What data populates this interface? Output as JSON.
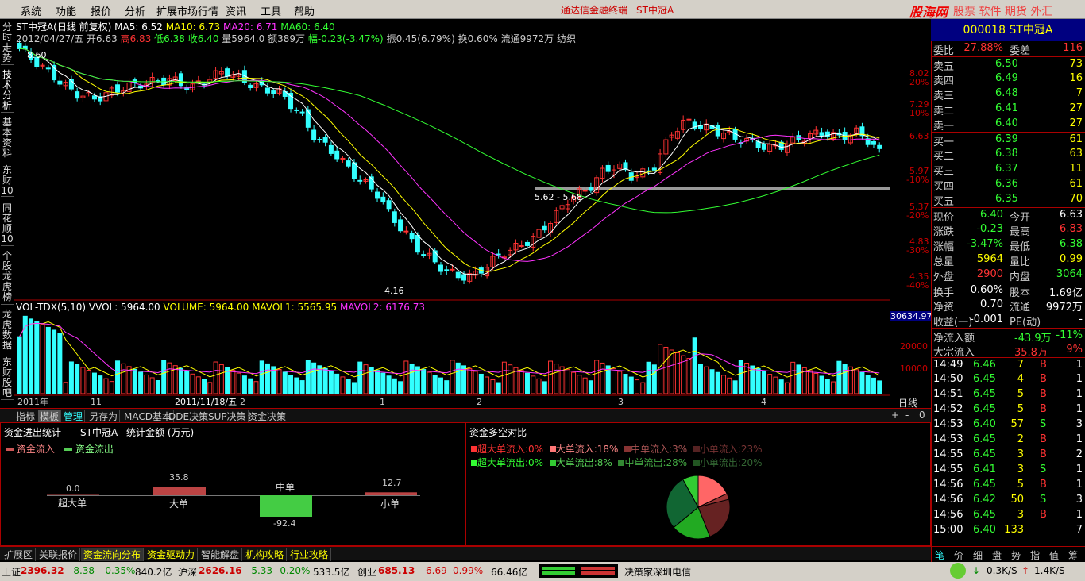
{
  "menu": {
    "items": [
      "系统",
      "功能",
      "报价",
      "分析",
      "扩展市场行情",
      "资讯",
      "工具",
      "帮助"
    ],
    "title_left": "通达信金融终端",
    "title_stock": "ST中冠A",
    "logo": "股海网",
    "logo_sub": "股票 软件 期货 外汇"
  },
  "left_tabs": [
    "分时走势",
    "技术分析",
    "基本资料",
    "东财10",
    "同花顺10",
    "个股龙虎榜",
    "龙虎数据",
    "东财股吧"
  ],
  "chart": {
    "info_line1": {
      "name": "ST中冠A(日线 前复权)",
      "ma5": "MA5: 6.52",
      "ma10": "MA10: 6.73",
      "ma20": "MA20: 6.71",
      "ma60": "MA60: 6.40"
    },
    "info_line2": {
      "date": "2012/04/27/五",
      "open": "开6.63",
      "high": "高6.83",
      "low": "低6.38",
      "close": "收6.40",
      "vol": "量5964.0",
      "amt": "额389万",
      "chg": "幅-0.23(-3.47%)",
      "amp": "振0.45(6.79%)",
      "turn": "换0.60%",
      "float": "流通9972万",
      "sector": "纺织"
    },
    "price_ticks": [
      "8.02",
      "20%",
      "7.29",
      "10%",
      "6.63",
      "5.97",
      "-10%",
      "5.37",
      "-20%",
      "4.83",
      "-30%",
      "4.35",
      "-40%"
    ],
    "annot_high": "8.60",
    "annot_low": "4.16",
    "annot_range": "5.62 - 5.68",
    "vol_line": {
      "name": "VOL-TDX(5,10)",
      "vvol": "VVOL: 5964.00",
      "volume": "VOLUME: 5964.00",
      "mavol1": "MAVOL1: 5565.95",
      "mavol2": "MAVOL2: 6176.73"
    },
    "vol_ticks": [
      "30634.97",
      "20000",
      "10000"
    ],
    "x_labels": [
      "2011年",
      "11",
      "2011/11/18/五",
      "2",
      "1",
      "2",
      "3",
      "4"
    ],
    "period": "日线"
  },
  "bottom_tabs": [
    "指标",
    "模板",
    "管理",
    "另存为",
    "MACD基本",
    "DDE决策",
    "SUP决策",
    "资金决策"
  ],
  "fund_left": {
    "title": "资金进出统计",
    "stock": "ST中冠A",
    "unit": "统计金额 (万元)",
    "legend_in": "资金流入",
    "legend_out": "资金流出",
    "bars": [
      {
        "label": "超大单",
        "value": "0.0"
      },
      {
        "label": "大单",
        "value": "35.8"
      },
      {
        "label": "中单",
        "value": "-92.4"
      },
      {
        "label": "小单",
        "value": "12.7"
      }
    ]
  },
  "fund_right": {
    "title": "资金多空对比",
    "in": [
      {
        "label": "超大单流入:",
        "value": "0%"
      },
      {
        "label": "大单流入:",
        "value": "18%"
      },
      {
        "label": "中单流入:",
        "value": "3%"
      },
      {
        "label": "小单流入:",
        "value": "23%"
      }
    ],
    "out": [
      {
        "label": "超大单流出:",
        "value": "0%"
      },
      {
        "label": "大单流出:",
        "value": "8%"
      },
      {
        "label": "中单流出:",
        "value": "28%"
      },
      {
        "label": "小单流出:",
        "value": "20%"
      }
    ]
  },
  "ext_tabs": [
    "扩展区",
    "关联报价",
    "资金流向分布",
    "资金驱动力",
    "智能解盘",
    "机构攻略",
    "行业攻略"
  ],
  "status": {
    "sh_name": "上证",
    "sh_val": "2396.32",
    "sh_chg": "-8.38",
    "sh_pct": "-0.35%",
    "sh_amt": "840.2亿",
    "sz_name": "沪深",
    "sz_val": "2626.16",
    "sz_chg": "-5.33",
    "sz_pct": "-0.20%",
    "sz_amt": "533.5亿",
    "cy_name": "创业",
    "cy_val": "685.13",
    "cy_chg": "6.69",
    "cy_pct": "0.99%",
    "cy_amt": "66.46亿",
    "broker": "决策家深圳电信",
    "down": "0.3K/S",
    "up": "1.4K/S"
  },
  "quote": {
    "header": "000018 ST中冠A",
    "weibi": {
      "l1": "委比",
      "v1": "27.88%",
      "l2": "委差",
      "v2": "116"
    },
    "sells": [
      {
        "l": "卖五",
        "p": "6.50",
        "v": "73"
      },
      {
        "l": "卖四",
        "p": "6.49",
        "v": "16"
      },
      {
        "l": "卖三",
        "p": "6.48",
        "v": "7"
      },
      {
        "l": "卖二",
        "p": "6.41",
        "v": "27"
      },
      {
        "l": "卖一",
        "p": "6.40",
        "v": "27"
      }
    ],
    "buys": [
      {
        "l": "买一",
        "p": "6.39",
        "v": "61"
      },
      {
        "l": "买二",
        "p": "6.38",
        "v": "63"
      },
      {
        "l": "买三",
        "p": "6.37",
        "v": "11"
      },
      {
        "l": "买四",
        "p": "6.36",
        "v": "61"
      },
      {
        "l": "买五",
        "p": "6.35",
        "v": "70"
      }
    ],
    "stats": [
      {
        "a": "现价",
        "av": "6.40",
        "b": "今开",
        "bv": "6.63"
      },
      {
        "a": "涨跌",
        "av": "-0.23",
        "b": "最高",
        "bv": "6.83"
      },
      {
        "a": "涨幅",
        "av": "-3.47%",
        "b": "最低",
        "bv": "6.38"
      },
      {
        "a": "总量",
        "av": "5964",
        "b": "量比",
        "bv": "0.99"
      },
      {
        "a": "外盘",
        "av": "2900",
        "b": "内盘",
        "bv": "3064"
      },
      {
        "a": "换手",
        "av": "0.60%",
        "b": "股本",
        "bv": "1.69亿"
      },
      {
        "a": "净资",
        "av": "0.70",
        "b": "流通",
        "bv": "9972万"
      },
      {
        "a": "收益(一)",
        "av": "-0.001",
        "b": "PE(动)",
        "bv": "-"
      }
    ],
    "netflow": {
      "l": "净流入额",
      "v": "-43.9万",
      "p": "-11%"
    },
    "bigflow": {
      "l": "大宗流入",
      "v": "35.8万",
      "p": "9%"
    },
    "ticks": [
      {
        "t": "14:49",
        "p": "6.46",
        "v": "7",
        "s": "B",
        "n": "1"
      },
      {
        "t": "14:50",
        "p": "6.45",
        "v": "4",
        "s": "B",
        "n": "1"
      },
      {
        "t": "14:51",
        "p": "6.45",
        "v": "5",
        "s": "B",
        "n": "1"
      },
      {
        "t": "14:52",
        "p": "6.45",
        "v": "5",
        "s": "B",
        "n": "1"
      },
      {
        "t": "14:53",
        "p": "6.40",
        "v": "57",
        "s": "S",
        "n": "3"
      },
      {
        "t": "14:53",
        "p": "6.45",
        "v": "2",
        "s": "B",
        "n": "1"
      },
      {
        "t": "14:55",
        "p": "6.45",
        "v": "3",
        "s": "B",
        "n": "2"
      },
      {
        "t": "14:55",
        "p": "6.41",
        "v": "3",
        "s": "S",
        "n": "1"
      },
      {
        "t": "14:56",
        "p": "6.45",
        "v": "5",
        "s": "B",
        "n": "1"
      },
      {
        "t": "14:56",
        "p": "6.42",
        "v": "50",
        "s": "S",
        "n": "3"
      },
      {
        "t": "14:56",
        "p": "6.45",
        "v": "3",
        "s": "B",
        "n": "1"
      },
      {
        "t": "15:00",
        "p": "6.40",
        "v": "133",
        "s": "",
        "n": "7"
      }
    ],
    "bottom_tabs": [
      "笔",
      "价",
      "细",
      "盘",
      "势",
      "指",
      "值",
      "筹"
    ]
  },
  "colors": {
    "up": "#ff3333",
    "down": "#33ffff",
    "ma5": "#ffffff",
    "ma10": "#ffff00",
    "ma20": "#ff33ff",
    "ma60": "#33ff33"
  }
}
